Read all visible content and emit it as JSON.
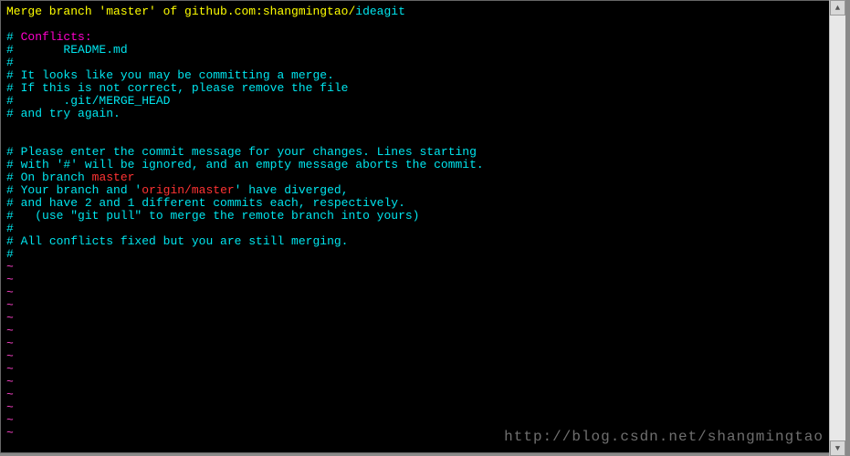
{
  "commit_message": {
    "prefix": "Merge branch 'master' of github.com:shangmingtao/",
    "repo_suffix": "ideagit"
  },
  "lines": [
    {
      "hash": "#",
      "body": " Conflicts:"
    },
    {
      "hash": "#",
      "body": "       README.md"
    },
    {
      "hash": "#",
      "body": ""
    },
    {
      "hash": "#",
      "body": " It looks like you may be committing a merge."
    },
    {
      "hash": "#",
      "body": " If this is not correct, please remove the file"
    },
    {
      "hash": "#",
      "body": "       .git/MERGE_HEAD"
    },
    {
      "hash": "#",
      "body": " and try again."
    }
  ],
  "section2_prefix": [
    {
      "hash": "#",
      "body": " Please enter the commit message for your changes. Lines starting"
    },
    {
      "hash": "#",
      "body": " with '#' will be ignored, and an empty message aborts the commit."
    }
  ],
  "branch_line": {
    "hash": "#",
    "prefix": " On branch ",
    "branch": "master"
  },
  "diverge_line": {
    "hash": "#",
    "prefix": " Your branch and '",
    "remote": "origin/master",
    "suffix": "' have diverged,"
  },
  "section2_suffix": [
    {
      "hash": "#",
      "body": " and have 2 and 1 different commits each, respectively."
    },
    {
      "hash": "#",
      "body": "   (use \"git pull\" to merge the remote branch into yours)"
    },
    {
      "hash": "#",
      "body": ""
    },
    {
      "hash": "#",
      "body": " All conflicts fixed but you are still merging."
    },
    {
      "hash": "#",
      "body": ""
    }
  ],
  "tilde": "~",
  "watermark": "http://blog.csdn.net/shangmingtao",
  "scroll_up_glyph": "▲",
  "scroll_down_glyph": "▼"
}
